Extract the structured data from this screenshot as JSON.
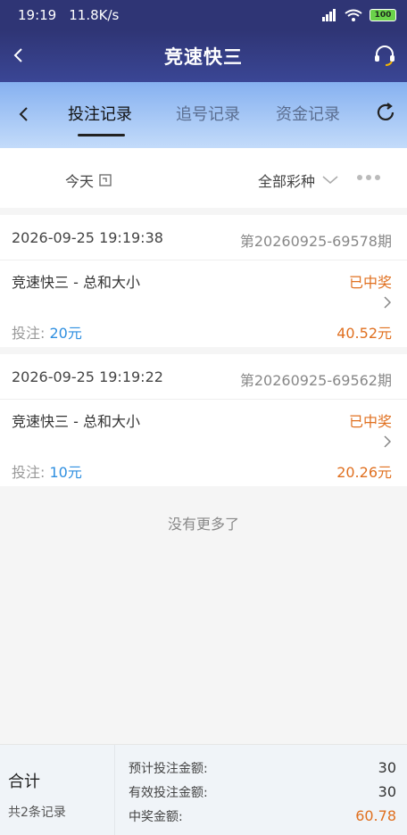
{
  "status_bar": {
    "time": "19:19",
    "speed": "11.8K/s",
    "battery": "100"
  },
  "header": {
    "title": "竞速快三"
  },
  "tabs": [
    {
      "label": "投注记录"
    },
    {
      "label": "追号记录"
    },
    {
      "label": "资金记录"
    }
  ],
  "filter": {
    "date_label": "今天",
    "type_label": "全部彩种"
  },
  "records": [
    {
      "time": "2026-09-25 19:19:38",
      "issue": "第20260925-69578期",
      "game": "竞速快三 - 总和大小",
      "status": "已中奖",
      "bet_label": "投注:",
      "bet_amount": "20元",
      "win_amount": "40.52元"
    },
    {
      "time": "2026-09-25 19:19:22",
      "issue": "第20260925-69562期",
      "game": "竞速快三 - 总和大小",
      "status": "已中奖",
      "bet_label": "投注:",
      "bet_amount": "10元",
      "win_amount": "20.26元"
    }
  ],
  "no_more_text": "没有更多了",
  "summary": {
    "title": "合计",
    "count": "共2条记录",
    "rows": [
      {
        "label": "预计投注金额:",
        "value": "30"
      },
      {
        "label": "有效投注金额:",
        "value": "30"
      },
      {
        "label": "中奖金额:",
        "value": "60.78"
      }
    ]
  },
  "colors": {
    "header_bg": "#2f3575",
    "win": "#e07020",
    "bet": "#2f8fe0"
  }
}
